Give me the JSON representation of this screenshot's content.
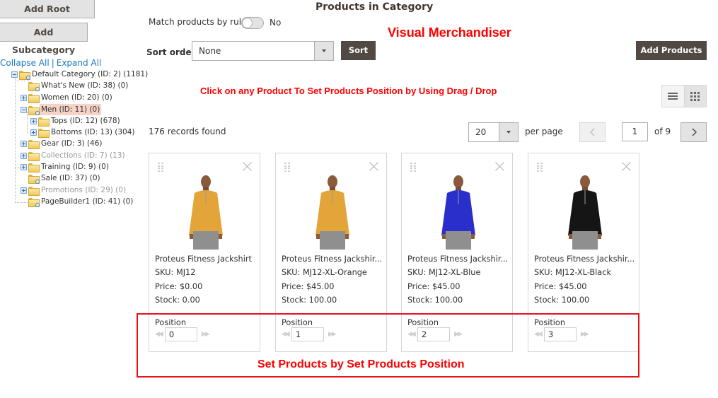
{
  "sidebar": {
    "add_root_label": "Add Root Category",
    "add_sub_label": "Add Subcategory",
    "collapse_all": "Collapse All",
    "separator": "|",
    "expand_all": "Expand All",
    "tree": [
      {
        "label": "Default Category (ID: 2) (1181)",
        "toggle": "minus",
        "icon": "folder-search",
        "state": "normal"
      },
      {
        "label": "What's New (ID: 38) (0)",
        "toggle": "none",
        "icon": "folder-search",
        "state": "normal"
      },
      {
        "label": "Women (ID: 20) (0)",
        "toggle": "plus",
        "icon": "folder",
        "state": "normal"
      },
      {
        "label": "Men (ID: 11) (0)",
        "toggle": "minus",
        "icon": "folder-search",
        "state": "selected"
      },
      {
        "label": "Tops (ID: 12) (678)",
        "toggle": "plus",
        "icon": "folder",
        "state": "normal"
      },
      {
        "label": "Bottoms (ID: 13) (304)",
        "toggle": "plus",
        "icon": "folder",
        "state": "normal"
      },
      {
        "label": "Gear (ID: 3) (46)",
        "toggle": "plus",
        "icon": "folder",
        "state": "normal"
      },
      {
        "label": "Collections (ID: 7) (13)",
        "toggle": "plus",
        "icon": "folder",
        "state": "disabled"
      },
      {
        "label": "Training (ID: 9) (0)",
        "toggle": "plus",
        "icon": "folder",
        "state": "normal"
      },
      {
        "label": "Sale (ID: 37) (0)",
        "toggle": "none",
        "icon": "folder-search",
        "state": "normal"
      },
      {
        "label": "Promotions (ID: 29) (0)",
        "toggle": "plus",
        "icon": "folder",
        "state": "disabled"
      },
      {
        "label": "PageBuilder1 (ID: 41) (0)",
        "toggle": "none",
        "icon": "folder-search",
        "state": "normal"
      }
    ]
  },
  "main": {
    "title": "Products in Category",
    "match_rule_label": "Match products by rule",
    "match_rule_value": "No",
    "match_rule_on": false,
    "sort_order_label": "Sort order",
    "sort_order_value": "None",
    "sort_button": "Sort",
    "add_products_button": "Add Products",
    "records_found": "176 records found",
    "per_page_value": "20",
    "per_page_label": "per page",
    "current_page": "1",
    "total_pages_label": "of 9",
    "view_mode": "grid",
    "products": [
      {
        "name": "Proteus Fitness Jackshirt",
        "sku": "SKU: MJ12",
        "price": "Price: $0.00",
        "stock": "Stock: 0.00",
        "position_label": "Position",
        "position": "0",
        "shirt_color": "#e3a43a"
      },
      {
        "name": "Proteus Fitness Jackshir...",
        "sku": "SKU: MJ12-XL-Orange",
        "price": "Price: $45.00",
        "stock": "Stock: 100.00",
        "position_label": "Position",
        "position": "1",
        "shirt_color": "#e3a43a"
      },
      {
        "name": "Proteus Fitness Jackshir...",
        "sku": "SKU: MJ12-XL-Blue",
        "price": "Price: $45.00",
        "stock": "Stock: 100.00",
        "position_label": "Position",
        "position": "2",
        "shirt_color": "#2a2fcc"
      },
      {
        "name": "Proteus Fitness Jackshir...",
        "sku": "SKU: MJ12-XL-Black",
        "price": "Price: $45.00",
        "stock": "Stock: 100.00",
        "position_label": "Position",
        "position": "3",
        "shirt_color": "#151515"
      }
    ]
  },
  "annotations": {
    "visual_merchandiser": "Visual Merchandiser",
    "drag_drop_hint": "Click on any Product To Set Products Position by Using Drag / Drop",
    "position_hint": "Set Products by Set Products Position",
    "color": "#ff0000"
  }
}
